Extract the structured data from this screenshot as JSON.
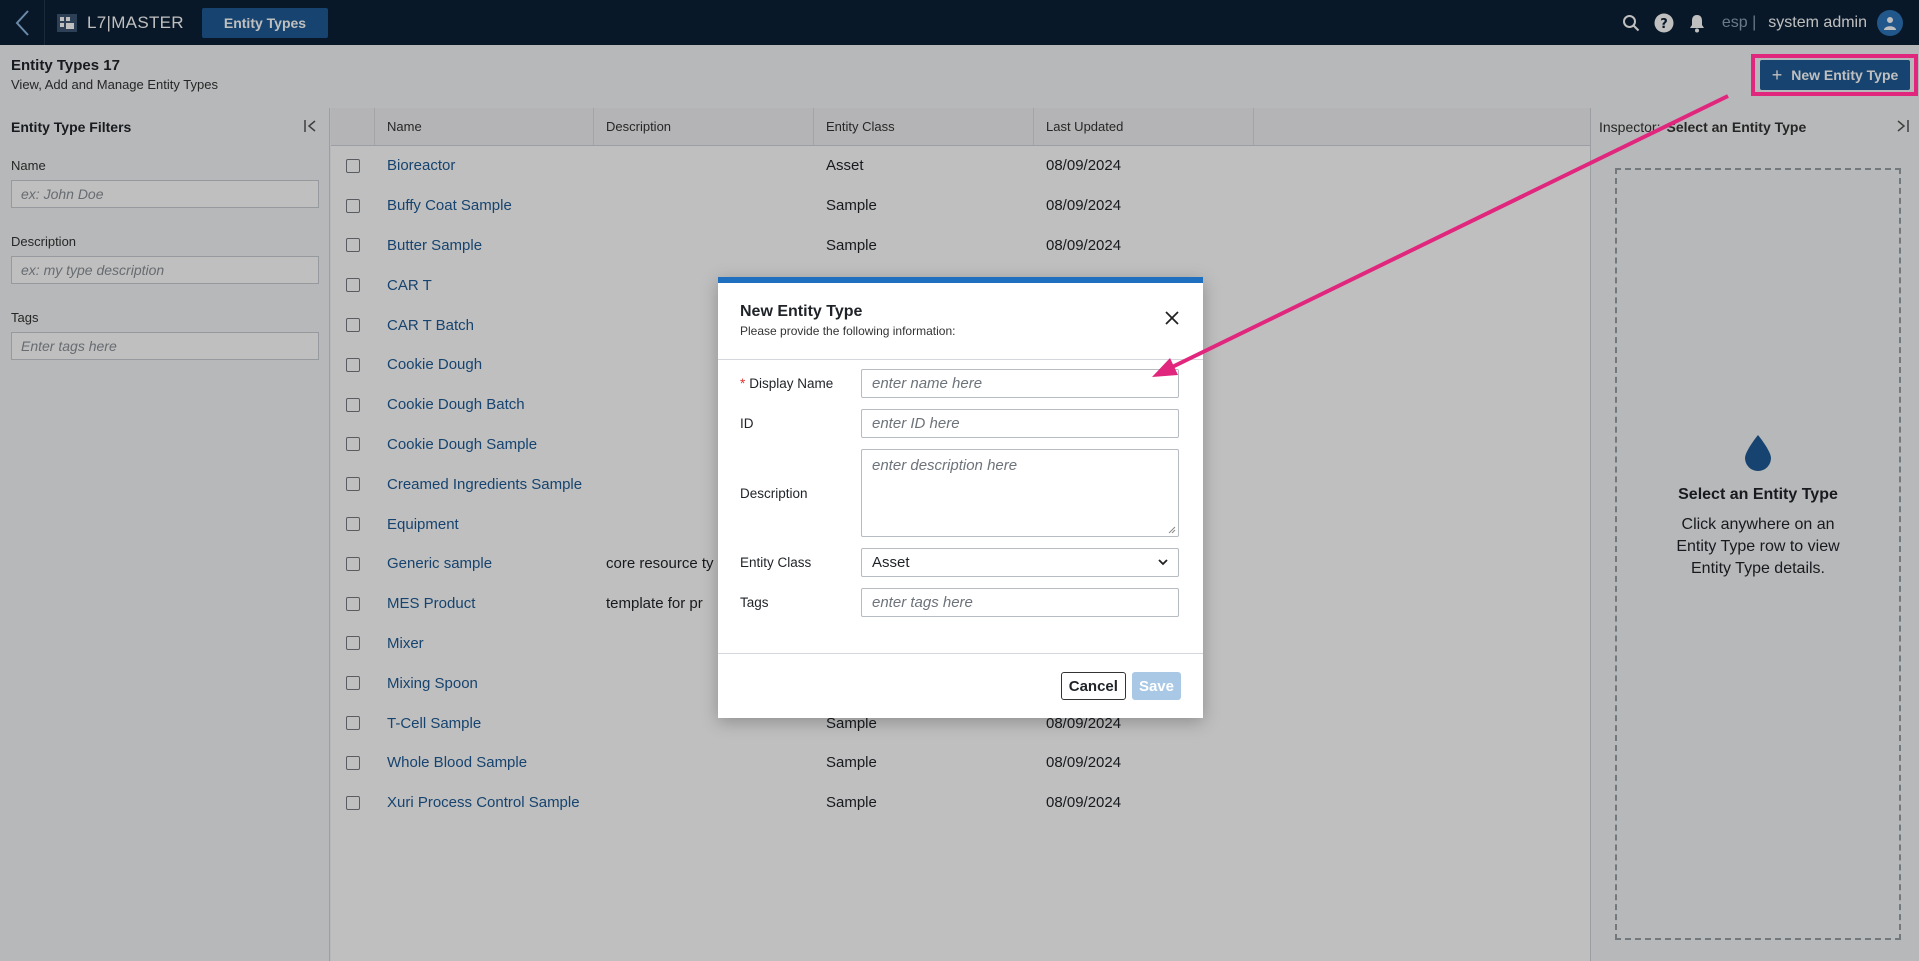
{
  "topbar": {
    "app_name": "L7|MASTER",
    "active_tab": "Entity Types",
    "lang": "esp |",
    "user": "system admin"
  },
  "page": {
    "title": "Entity Types 17",
    "subtitle": "View, Add and Manage Entity Types",
    "new_button": "New Entity Type"
  },
  "filters": {
    "title": "Entity Type Filters",
    "name_label": "Name",
    "name_placeholder": "ex: John Doe",
    "desc_label": "Description",
    "desc_placeholder": "ex: my type description",
    "tags_label": "Tags",
    "tags_placeholder": "Enter tags here"
  },
  "table": {
    "columns": [
      "Name",
      "Description",
      "Entity Class",
      "Last Updated"
    ],
    "rows": [
      {
        "name": "Bioreactor",
        "desc": "",
        "cls": "Asset",
        "upd": "08/09/2024"
      },
      {
        "name": "Buffy Coat Sample",
        "desc": "",
        "cls": "Sample",
        "upd": "08/09/2024"
      },
      {
        "name": "Butter Sample",
        "desc": "",
        "cls": "Sample",
        "upd": "08/09/2024"
      },
      {
        "name": "CAR T",
        "desc": "",
        "cls": "",
        "upd": ""
      },
      {
        "name": "CAR T Batch",
        "desc": "",
        "cls": "",
        "upd": ""
      },
      {
        "name": "Cookie Dough",
        "desc": "",
        "cls": "",
        "upd": ""
      },
      {
        "name": "Cookie Dough Batch",
        "desc": "",
        "cls": "",
        "upd": ""
      },
      {
        "name": "Cookie Dough Sample",
        "desc": "",
        "cls": "",
        "upd": ""
      },
      {
        "name": "Creamed Ingredients Sample",
        "desc": "",
        "cls": "",
        "upd": ""
      },
      {
        "name": "Equipment",
        "desc": "",
        "cls": "",
        "upd": ""
      },
      {
        "name": "Generic sample",
        "desc": "core resource ty",
        "cls": "",
        "upd": ""
      },
      {
        "name": "MES Product",
        "desc": "template for pr",
        "cls": "",
        "upd": ""
      },
      {
        "name": "Mixer",
        "desc": "",
        "cls": "",
        "upd": ""
      },
      {
        "name": "Mixing Spoon",
        "desc": "",
        "cls": "",
        "upd": ""
      },
      {
        "name": "T-Cell Sample",
        "desc": "",
        "cls": "Sample",
        "upd": "08/09/2024"
      },
      {
        "name": "Whole Blood Sample",
        "desc": "",
        "cls": "Sample",
        "upd": "08/09/2024"
      },
      {
        "name": "Xuri Process Control Sample",
        "desc": "",
        "cls": "Sample",
        "upd": "08/09/2024"
      }
    ]
  },
  "inspector": {
    "label": "Inspector:",
    "selection": "Select an Entity Type",
    "empty_title": "Select an Entity Type",
    "empty_text": "Click anywhere on an Entity Type row to view Entity Type details."
  },
  "modal": {
    "title": "New Entity Type",
    "subtitle": "Please provide the following information:",
    "required_mark": "*",
    "display_name_label": "Display Name",
    "display_name_placeholder": "enter name here",
    "id_label": "ID",
    "id_placeholder": "enter ID here",
    "desc_label": "Description",
    "desc_placeholder": "enter description here",
    "class_label": "Entity Class",
    "class_value": "Asset",
    "tags_label": "Tags",
    "tags_placeholder": "enter tags here",
    "cancel": "Cancel",
    "save": "Save"
  },
  "colors": {
    "topbar": "#0d2137",
    "primary": "#1e5a94",
    "highlight": "#e0267d"
  }
}
